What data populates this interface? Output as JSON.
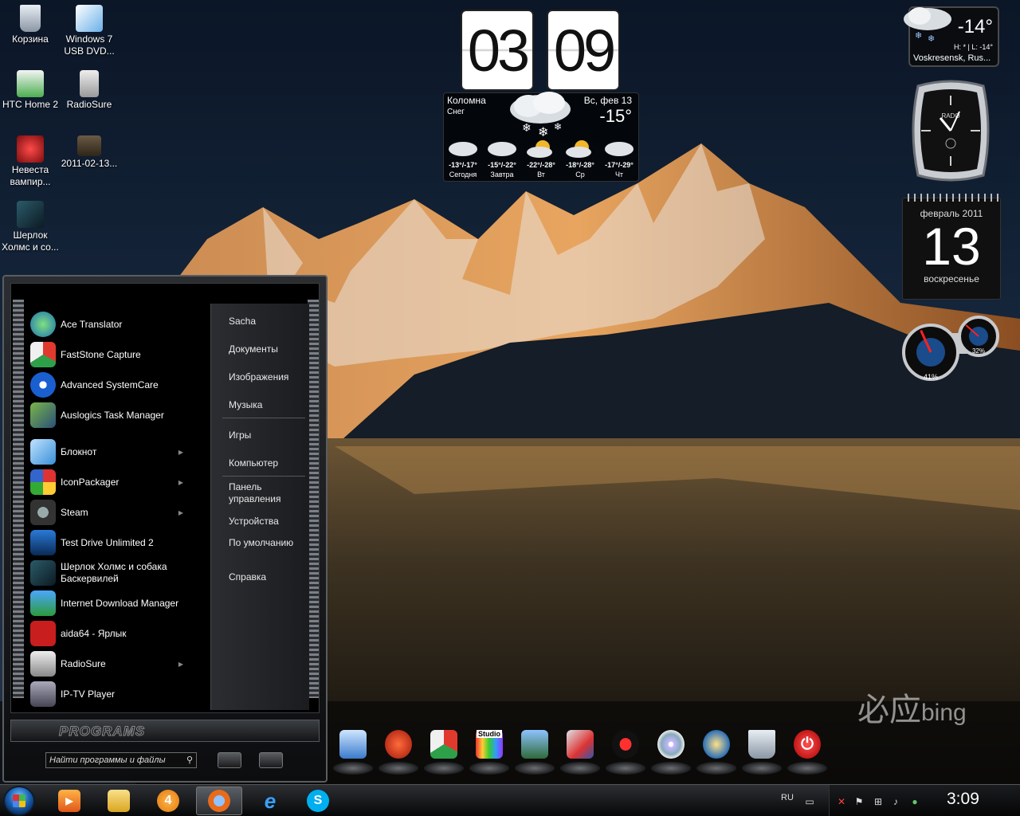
{
  "desktop_icons": [
    {
      "label": "Корзина",
      "icon": "recycle-bin-icon"
    },
    {
      "label": "Windows 7 USB DVD...",
      "icon": "usb-dvd-tool-icon"
    },
    {
      "label": "HTC Home 2",
      "icon": "htc-home-icon"
    },
    {
      "label": "RadioSure",
      "icon": "radiosure-icon"
    },
    {
      "label": "Невеста вампир...",
      "icon": "game-icon"
    },
    {
      "label": "2011-02-13...",
      "icon": "video-file-icon"
    },
    {
      "label": "Шерлок Холмс и со...",
      "icon": "game-icon"
    }
  ],
  "start_menu": {
    "programs": [
      {
        "label": "Ace Translator",
        "icon": "globe-icon",
        "has_submenu": false
      },
      {
        "label": "FastStone Capture",
        "icon": "faststone-icon",
        "has_submenu": false
      },
      {
        "label": "Advanced SystemCare",
        "icon": "systemcare-icon",
        "has_submenu": false
      },
      {
        "label": "Auslogics Task Manager",
        "icon": "task-manager-icon",
        "has_submenu": false
      },
      {
        "label": "Блокнот",
        "icon": "notepad-icon",
        "has_submenu": true
      },
      {
        "label": "IconPackager",
        "icon": "iconpackager-icon",
        "has_submenu": true
      },
      {
        "label": "Steam",
        "icon": "steam-icon",
        "has_submenu": true
      },
      {
        "label": "Test Drive Unlimited 2",
        "icon": "tdu2-icon",
        "has_submenu": false
      },
      {
        "label": "Шерлок Холмс и собака Баскервилей",
        "icon": "game-icon",
        "has_submenu": false
      },
      {
        "label": "Internet Download Manager",
        "icon": "idm-icon",
        "has_submenu": false
      },
      {
        "label": "aida64 - Ярлык",
        "icon": "aida64-icon",
        "has_submenu": false
      },
      {
        "label": "RadioSure",
        "icon": "radiosure-icon",
        "has_submenu": true
      },
      {
        "label": "IP-TV Player",
        "icon": "tv-icon",
        "has_submenu": false
      }
    ],
    "places": [
      "Sacha",
      "Документы",
      "Изображения",
      "Музыка",
      "Игры",
      "Компьютер",
      "Панель управления",
      "Устройства",
      "По умолчанию",
      "Справка"
    ],
    "programs_label": "PROGRAMS",
    "search_placeholder": "Найти программы и файлы"
  },
  "clock_gadget": {
    "hours": "03",
    "minutes": "09",
    "city": "Коломна",
    "condition": "Снег",
    "date": "Вс, фев 13",
    "temperature": "-15°",
    "forecast": [
      {
        "temps": "-13°/-17°",
        "day": "Сегодня",
        "sky": "snow"
      },
      {
        "temps": "-15°/-22°",
        "day": "Завтра",
        "sky": "snow"
      },
      {
        "temps": "-22°/-28°",
        "day": "Вт",
        "sky": "sun-cloud"
      },
      {
        "temps": "-18°/-28°",
        "day": "Ср",
        "sky": "sun-cloud"
      },
      {
        "temps": "-17°/-29°",
        "day": "Чт",
        "sky": "cloud"
      }
    ]
  },
  "mini_weather": {
    "temperature": "-14°",
    "hi_lo": "H: * | L: -14°",
    "location": "Voskresensk, Rus..."
  },
  "watch": {
    "brand": "RADO"
  },
  "calendar": {
    "month_year": "февраль 2011",
    "day": "13",
    "weekday": "воскресенье"
  },
  "cpu_meter": {
    "cpu": "41%",
    "ram": "32%",
    "cpu_fraction": 0.41,
    "ram_fraction": 0.32
  },
  "watermark": {
    "chinese": "必应",
    "latin": "bing"
  },
  "dock": [
    {
      "icon": "system-tools-icon"
    },
    {
      "icon": "ccleaner-icon"
    },
    {
      "icon": "faststone-icon"
    },
    {
      "icon": "studio-icon",
      "label": "Studio"
    },
    {
      "icon": "photo-viewer-icon"
    },
    {
      "icon": "control-tools-icon"
    },
    {
      "icon": "joystick-icon"
    },
    {
      "icon": "dvd-icon"
    },
    {
      "icon": "network-globe-icon"
    },
    {
      "icon": "recycle-bin-icon"
    },
    {
      "icon": "power-icon"
    }
  ],
  "taskbar": {
    "items": [
      {
        "icon": "media-player-icon"
      },
      {
        "icon": "file-explorer-icon"
      },
      {
        "icon": "ie4-icon",
        "label": "4"
      },
      {
        "icon": "firefox-icon",
        "active": true
      },
      {
        "icon": "internet-explorer-icon",
        "label": "e"
      },
      {
        "icon": "skype-icon",
        "label": "S"
      }
    ],
    "language": "RU",
    "time": "3:09"
  },
  "colors": {
    "accent_orange": "#e8902e",
    "sky": "#16263c",
    "lake": "#2a2015",
    "taskbar": "#1b1d20"
  }
}
